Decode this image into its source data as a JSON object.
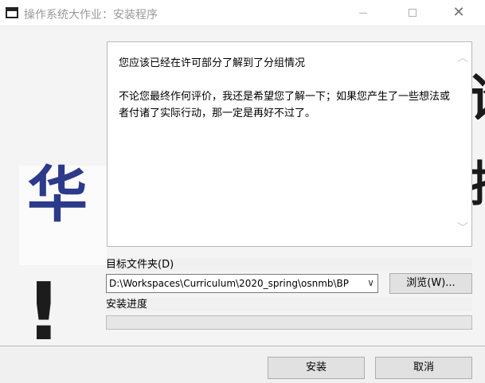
{
  "window": {
    "title": "操作系统大作业：安装程序",
    "minimize_icon": "minimize-icon",
    "maximize_icon": "maximize-icon",
    "close_icon": "close-icon"
  },
  "background": {
    "glyph_left": "华",
    "glyph_exclaim": "!",
    "glyph_right_top": "论",
    "glyph_right_mid": "持"
  },
  "info": {
    "paragraph_1": "您应该已经在许可部分了解到了分组情况",
    "paragraph_2": "不论您最终作何评价，我还是希望您了解一下；如果您产生了一些想法或者付诸了实际行动，那一定是再好不过了。",
    "scroll_up_icon": "scroll-up-arrow-icon",
    "scroll_down_icon": "scroll-down-arrow-icon"
  },
  "target": {
    "label": "目标文件夹(D)",
    "path": "D:\\Workspaces\\Curriculum\\2020_spring\\osnmb\\BP",
    "browse_label": "浏览(W)..."
  },
  "progress": {
    "label": "安装进度",
    "value": 0,
    "fill_color": "#06b025"
  },
  "footer": {
    "install_label": "安装",
    "cancel_label": "取消"
  }
}
